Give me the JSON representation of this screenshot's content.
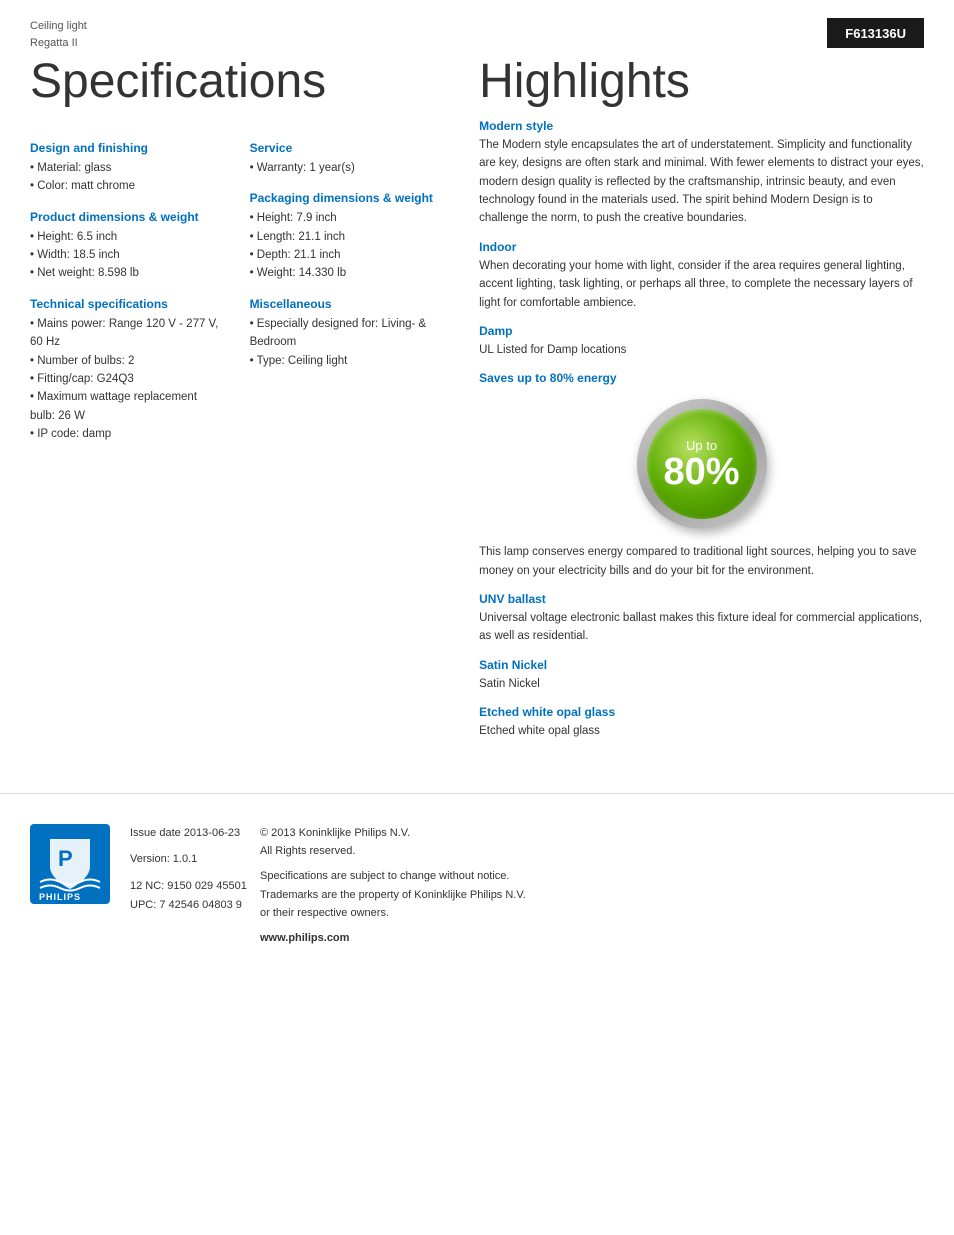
{
  "product": {
    "category": "Ceiling light",
    "model": "Regatta II",
    "code": "F613136U"
  },
  "left_title": "Specifications",
  "right_title": "Highlights",
  "specs": {
    "design_finishing": {
      "heading": "Design and finishing",
      "items": [
        "Material: glass",
        "Color: matt chrome"
      ]
    },
    "product_dimensions": {
      "heading": "Product dimensions & weight",
      "items": [
        "Height: 6.5 inch",
        "Width: 18.5 inch",
        "Net weight: 8.598 lb"
      ]
    },
    "technical": {
      "heading": "Technical specifications",
      "items": [
        "Mains power: Range 120 V - 277 V, 60 Hz",
        "Number of bulbs: 2",
        "Fitting/cap: G24Q3",
        "Maximum wattage replacement bulb: 26 W",
        "IP code: damp"
      ]
    },
    "service": {
      "heading": "Service",
      "items": [
        "Warranty: 1 year(s)"
      ]
    },
    "packaging": {
      "heading": "Packaging dimensions & weight",
      "items": [
        "Height: 7.9 inch",
        "Length: 21.1 inch",
        "Depth: 21.1 inch",
        "Weight: 14.330 lb"
      ]
    },
    "miscellaneous": {
      "heading": "Miscellaneous",
      "items": [
        "Especially designed for: Living- & Bedroom",
        "Type: Ceiling light"
      ]
    }
  },
  "highlights": {
    "modern_style": {
      "heading": "Modern style",
      "text": "The Modern style encapsulates the art of understatement. Simplicity and functionality are key, designs are often stark and minimal. With fewer elements to distract your eyes, modern design quality is reflected by the craftsmanship, intrinsic beauty, and even technology found in the materials used. The spirit behind Modern Design is to challenge the norm, to push the creative boundaries."
    },
    "indoor": {
      "heading": "Indoor",
      "text": "When decorating your home with light, consider if the area requires general lighting, accent lighting, task lighting, or perhaps all three, to complete the necessary layers of light for comfortable ambience."
    },
    "damp": {
      "heading": "Damp",
      "text": "UL Listed for Damp locations"
    },
    "saves_energy": {
      "heading": "Saves up to 80% energy",
      "badge_upto": "Up to",
      "badge_percent": "80%"
    },
    "energy_text": "This lamp conserves energy compared to traditional light sources, helping you to save money on your electricity bills and do your bit for the environment.",
    "unv_ballast": {
      "heading": "UNV ballast",
      "text": "Universal voltage electronic ballast makes this fixture ideal for commercial applications, as well as residential."
    },
    "satin_nickel": {
      "heading": "Satin Nickel",
      "text": "Satin Nickel"
    },
    "etched_glass": {
      "heading": "Etched white opal glass",
      "text": "Etched white opal glass"
    }
  },
  "footer": {
    "issue_label": "Issue date 2013-06-23",
    "version_label": "Version: 1.0.1",
    "nc": "12 NC: 9150 029 45501",
    "upc": "UPC: 7 42546 04803 9",
    "copyright": "© 2013 Koninklijke Philips N.V.",
    "rights": "All Rights reserved.",
    "specs_note": "Specifications are subject to change without notice.",
    "trademark": "Trademarks are the property of Koninklijke Philips N.V.",
    "trademark2": "or their respective owners.",
    "website": "www.philips.com"
  }
}
